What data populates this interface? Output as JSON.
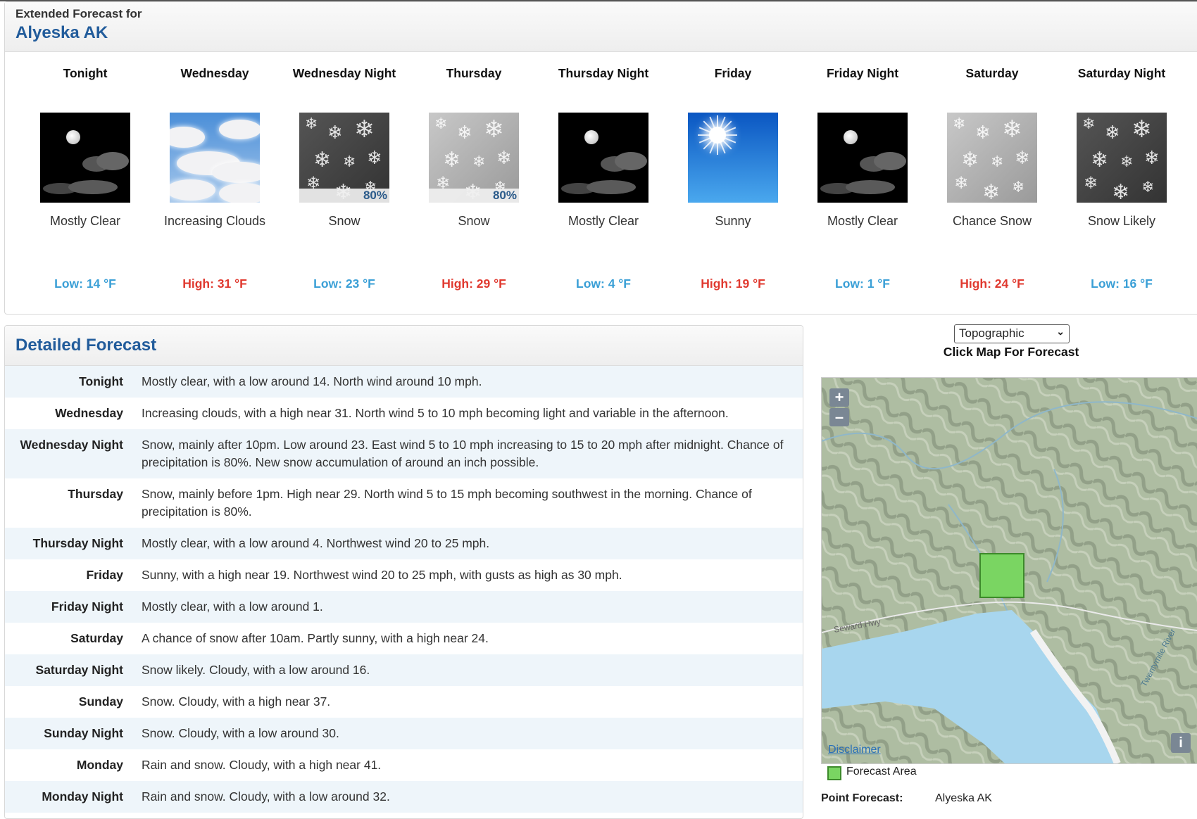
{
  "extended": {
    "subtitle": "Extended Forecast for",
    "location": "Alyeska AK",
    "periods": [
      {
        "name": "Tonight",
        "desc": "Mostly Clear",
        "temp": "Low: 14 °F",
        "kind": "low",
        "icon": "night-few-clouds-icon"
      },
      {
        "name": "Wednesday",
        "desc": "Increasing Clouds",
        "temp": "High: 31 °F",
        "kind": "high",
        "icon": "increasing-clouds-icon"
      },
      {
        "name": "Wednesday Night",
        "desc": "Snow",
        "temp": "Low: 23 °F",
        "kind": "low",
        "icon": "snow-night-icon",
        "pop": "80%"
      },
      {
        "name": "Thursday",
        "desc": "Snow",
        "temp": "High: 29 °F",
        "kind": "high",
        "icon": "snow-day-icon",
        "pop": "80%"
      },
      {
        "name": "Thursday Night",
        "desc": "Mostly Clear",
        "temp": "Low: 4 °F",
        "kind": "low",
        "icon": "night-few-clouds-icon"
      },
      {
        "name": "Friday",
        "desc": "Sunny",
        "temp": "High: 19 °F",
        "kind": "high",
        "icon": "sunny-icon"
      },
      {
        "name": "Friday Night",
        "desc": "Mostly Clear",
        "temp": "Low: 1 °F",
        "kind": "low",
        "icon": "night-few-clouds-icon"
      },
      {
        "name": "Saturday",
        "desc": "Chance Snow",
        "temp": "High: 24 °F",
        "kind": "high",
        "icon": "snow-day-icon"
      },
      {
        "name": "Saturday Night",
        "desc": "Snow Likely",
        "temp": "Low: 16 °F",
        "kind": "low",
        "icon": "snow-night-icon"
      }
    ]
  },
  "detailed": {
    "title": "Detailed Forecast",
    "rows": [
      {
        "label": "Tonight",
        "text": "Mostly clear, with a low around 14. North wind around 10 mph."
      },
      {
        "label": "Wednesday",
        "text": "Increasing clouds, with a high near 31. North wind 5 to 10 mph becoming light and variable in the afternoon."
      },
      {
        "label": "Wednesday Night",
        "text": "Snow, mainly after 10pm. Low around 23. East wind 5 to 10 mph increasing to 15 to 20 mph after midnight. Chance of precipitation is 80%. New snow accumulation of around an inch possible."
      },
      {
        "label": "Thursday",
        "text": "Snow, mainly before 1pm. High near 29. North wind 5 to 15 mph becoming southwest in the morning. Chance of precipitation is 80%."
      },
      {
        "label": "Thursday Night",
        "text": "Mostly clear, with a low around 4. Northwest wind 20 to 25 mph."
      },
      {
        "label": "Friday",
        "text": "Sunny, with a high near 19. Northwest wind 20 to 25 mph, with gusts as high as 30 mph."
      },
      {
        "label": "Friday Night",
        "text": "Mostly clear, with a low around 1."
      },
      {
        "label": "Saturday",
        "text": "A chance of snow after 10am. Partly sunny, with a high near 24."
      },
      {
        "label": "Saturday Night",
        "text": "Snow likely. Cloudy, with a low around 16."
      },
      {
        "label": "Sunday",
        "text": "Snow. Cloudy, with a high near 37."
      },
      {
        "label": "Sunday Night",
        "text": "Snow. Cloudy, with a low around 30."
      },
      {
        "label": "Monday",
        "text": "Rain and snow. Cloudy, with a high near 41."
      },
      {
        "label": "Monday Night",
        "text": "Rain and snow. Cloudy, with a low around 32."
      }
    ]
  },
  "map": {
    "select_value": "Topographic",
    "caption": "Click Map For Forecast",
    "zoom_in": "+",
    "zoom_out": "–",
    "info": "i",
    "disclaimer": "Disclaimer",
    "road_label": "Seward Hwy",
    "river_label": "Twentymile River",
    "legend": "Forecast Area",
    "point_forecast_label": "Point Forecast:",
    "point_forecast_value": "Alyeska AK"
  },
  "colors": {
    "title_blue": "#225c9b",
    "low_temp": "#3a9fd6",
    "high_temp": "#e0392f",
    "row_stripe": "#eef5fa",
    "forecast_area": "#7ad562"
  }
}
